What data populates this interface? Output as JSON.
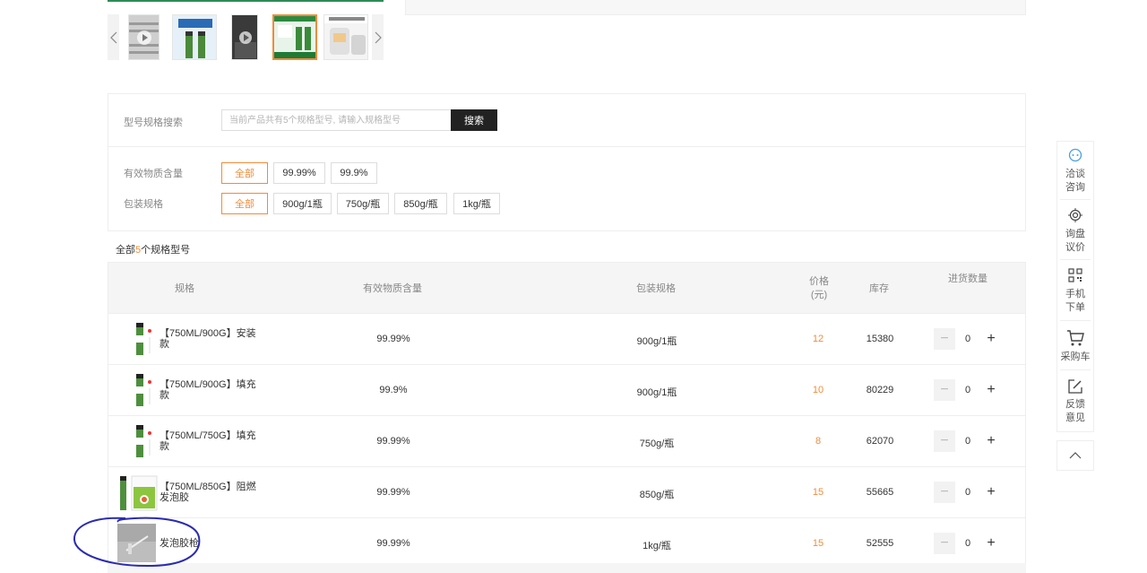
{
  "search": {
    "label": "型号规格搜索",
    "placeholder": "当前产品共有5个规格型号, 请输入规格型号",
    "button": "搜索"
  },
  "filters": [
    {
      "label": "有效物质含量",
      "options": [
        "全部",
        "99.99%",
        "99.9%"
      ],
      "selected": 0
    },
    {
      "label": "包装规格",
      "options": [
        "全部",
        "900g/1瓶",
        "750g/瓶",
        "850g/瓶",
        "1kg/瓶"
      ],
      "selected": 0
    }
  ],
  "summary": {
    "prefix": "全部",
    "count": "5",
    "suffix": "个规格型号"
  },
  "table": {
    "headers": {
      "spec": "规格",
      "content": "有效物质含量",
      "package": "包装规格",
      "price_line1": "价格",
      "price_line2": "(元)",
      "stock": "库存",
      "qty": "进货数量"
    },
    "rows": [
      {
        "name_line1": "【750ML/900G】安装",
        "name_line2": "款",
        "content": "99.99%",
        "package": "900g/1瓶",
        "price": "12",
        "stock": "15380",
        "qty": "0"
      },
      {
        "name_line1": "【750ML/900G】填充",
        "name_line2": "款",
        "content": "99.9%",
        "package": "900g/1瓶",
        "price": "10",
        "stock": "80229",
        "qty": "0"
      },
      {
        "name_line1": "【750ML/750G】填充",
        "name_line2": "款",
        "content": "99.99%",
        "package": "750g/瓶",
        "price": "8",
        "stock": "62070",
        "qty": "0"
      },
      {
        "name_line1": "【750ML/850G】阻燃",
        "name_line2": "发泡胶",
        "content": "99.99%",
        "package": "850g/瓶",
        "price": "15",
        "stock": "55665",
        "qty": "0"
      },
      {
        "name_line1": "发泡胶枪",
        "name_line2": "",
        "content": "99.99%",
        "package": "1kg/瓶",
        "price": "15",
        "stock": "52555",
        "qty": "0"
      }
    ]
  },
  "sidebar": {
    "items": [
      {
        "line1": "洽谈",
        "line2": "咨询",
        "icon": "chat-icon"
      },
      {
        "line1": "询盘",
        "line2": "议价",
        "icon": "target-icon"
      },
      {
        "line1": "手机",
        "line2": "下单",
        "icon": "qrcode-icon"
      },
      {
        "line1": "采购车",
        "line2": "",
        "icon": "cart-icon"
      },
      {
        "line1": "反馈",
        "line2": "意见",
        "icon": "edit-icon"
      }
    ],
    "top_icon": "chevron-up-icon"
  },
  "colors": {
    "accent": "#f08c3a",
    "dark_button": "#222222",
    "annotation": "#2b2bb0"
  }
}
